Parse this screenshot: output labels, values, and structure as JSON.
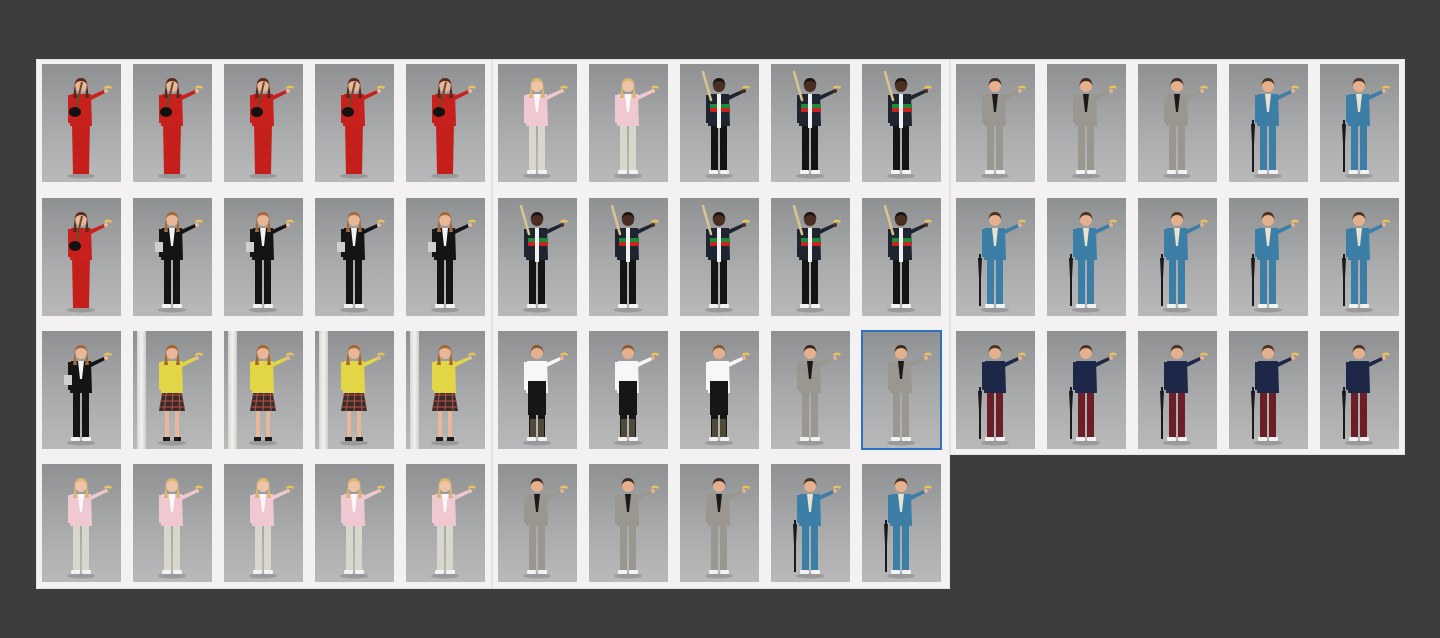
{
  "colors": {
    "background": "#3d3d3d",
    "sheet": "#f3f1f1",
    "selection": "#2f6fc4"
  },
  "sheets": [
    {
      "name": "sheet-1",
      "rows": [
        [
          "red-dress-guitar",
          "red-dress-guitar",
          "red-dress-guitar",
          "red-dress-guitar",
          "red-dress-guitar"
        ],
        [
          "red-dress-guitar",
          "black-suit-woman",
          "black-suit-woman",
          "black-suit-woman",
          "black-suit-woman"
        ],
        [
          "black-suit-woman",
          "yellow-top-plaid",
          "yellow-top-plaid",
          "yellow-top-plaid",
          "yellow-top-plaid"
        ],
        [
          "pink-outfit",
          "pink-outfit",
          "pink-outfit",
          "pink-outfit",
          "pink-outfit"
        ]
      ]
    },
    {
      "name": "sheet-2",
      "rows": [
        [
          "pink-outfit",
          "pink-outfit",
          "green-red-sweater",
          "green-red-sweater",
          "green-red-sweater"
        ],
        [
          "green-red-sweater",
          "green-red-sweater",
          "green-red-sweater",
          "green-red-sweater",
          "green-red-sweater"
        ],
        [
          "chef-apron",
          "chef-apron",
          "chef-apron",
          "grey-suit",
          "grey-suit"
        ],
        [
          "grey-suit",
          "grey-suit",
          "grey-suit",
          "blue-suit-umbrella",
          "blue-suit-umbrella"
        ]
      ]
    },
    {
      "name": "sheet-3",
      "rows": [
        [
          "grey-suit",
          "grey-suit",
          "grey-suit",
          "blue-suit-umbrella",
          "blue-suit-umbrella"
        ],
        [
          "blue-suit-umbrella",
          "blue-suit-umbrella",
          "blue-suit-umbrella",
          "blue-suit-umbrella",
          "blue-suit-umbrella"
        ],
        [
          "navy-burgundy-umbrella",
          "navy-burgundy-umbrella",
          "navy-burgundy-umbrella",
          "navy-burgundy-umbrella",
          "navy-burgundy-umbrella"
        ]
      ]
    }
  ],
  "selected": {
    "sheet": 1,
    "row": 2,
    "col": 4
  }
}
